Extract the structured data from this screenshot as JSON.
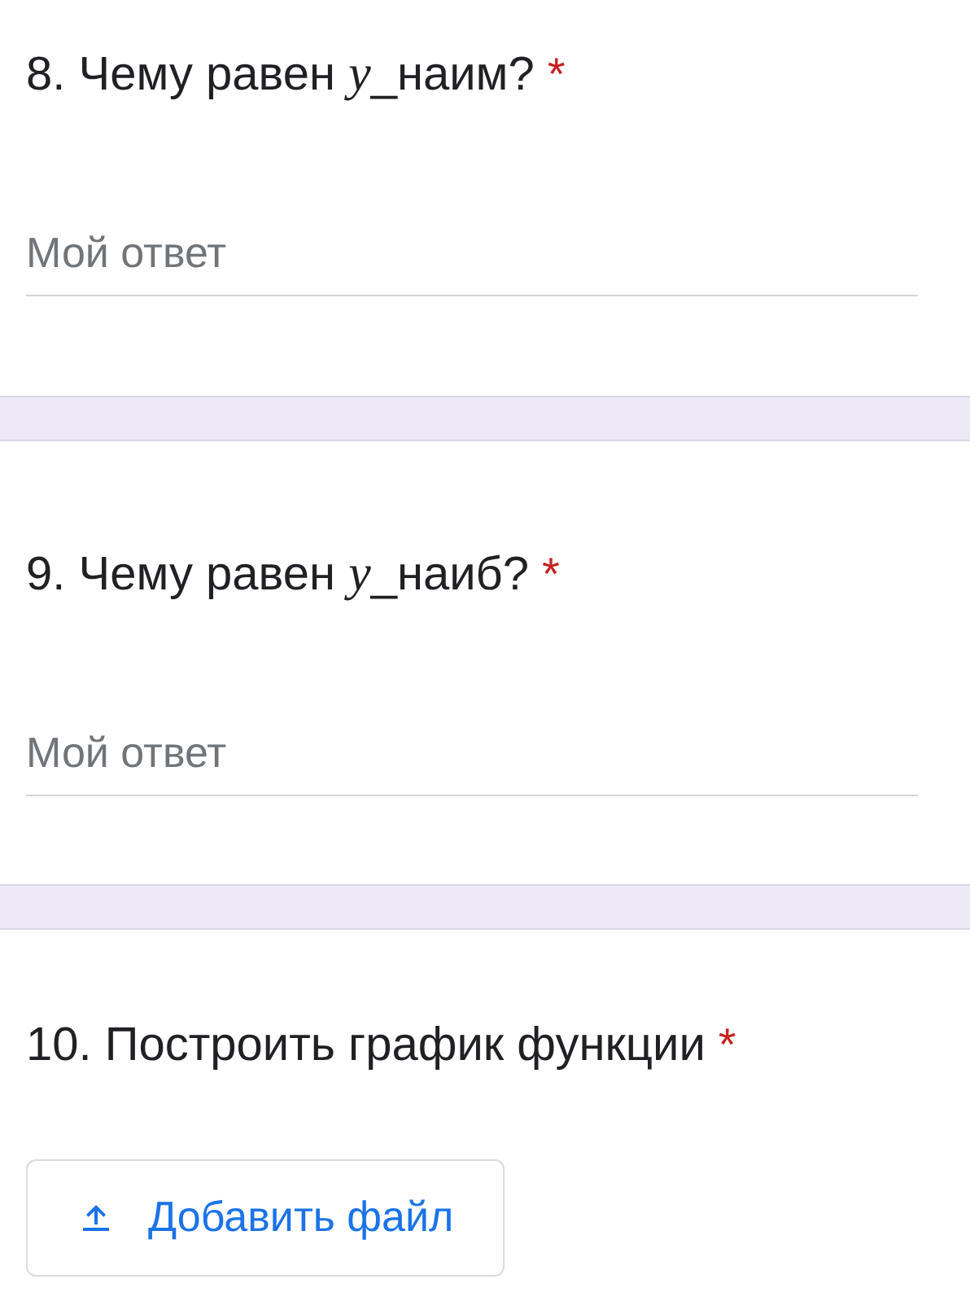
{
  "questions": [
    {
      "kind": "text",
      "title": [
        "8. Чему равен ",
        "y",
        "_наим?"
      ],
      "required_mark": "*",
      "placeholder": "Мой ответ"
    },
    {
      "kind": "text",
      "title": [
        "9. Чему равен ",
        "y",
        "_наиб?"
      ],
      "required_mark": "*",
      "placeholder": "Мой ответ"
    },
    {
      "kind": "file",
      "title": [
        "10. Построить график функции"
      ],
      "required_mark": "*",
      "button": "Добавить файл"
    }
  ]
}
